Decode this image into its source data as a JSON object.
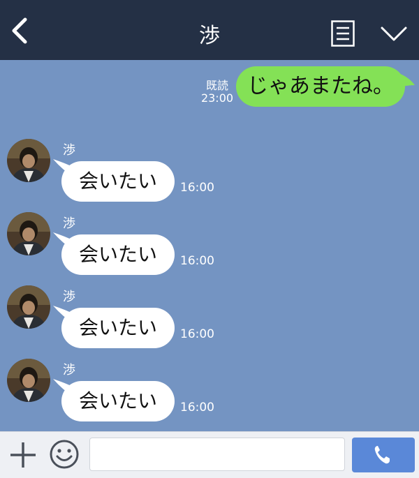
{
  "header": {
    "title": "渉",
    "back_icon": "chevron-left-icon",
    "menu_icon": "notes-icon",
    "expand_icon": "chevron-down-icon"
  },
  "sent_message": {
    "text": "じゃあまたね。",
    "read_label": "既読",
    "time": "23:00"
  },
  "received_messages": [
    {
      "sender": "渉",
      "text": "会いたい",
      "time": "16:00"
    },
    {
      "sender": "渉",
      "text": "会いたい",
      "time": "16:00"
    },
    {
      "sender": "渉",
      "text": "会いたい",
      "time": "16:00"
    },
    {
      "sender": "渉",
      "text": "会いたい",
      "time": "16:00"
    }
  ],
  "input_bar": {
    "placeholder": "",
    "plus_icon": "plus-icon",
    "emoji_icon": "smiley-icon",
    "call_icon": "phone-icon"
  },
  "colors": {
    "header_bg": "#243045",
    "chat_bg": "#7494c2",
    "sent_bubble": "#84e156",
    "call_button": "#5a88d8"
  }
}
